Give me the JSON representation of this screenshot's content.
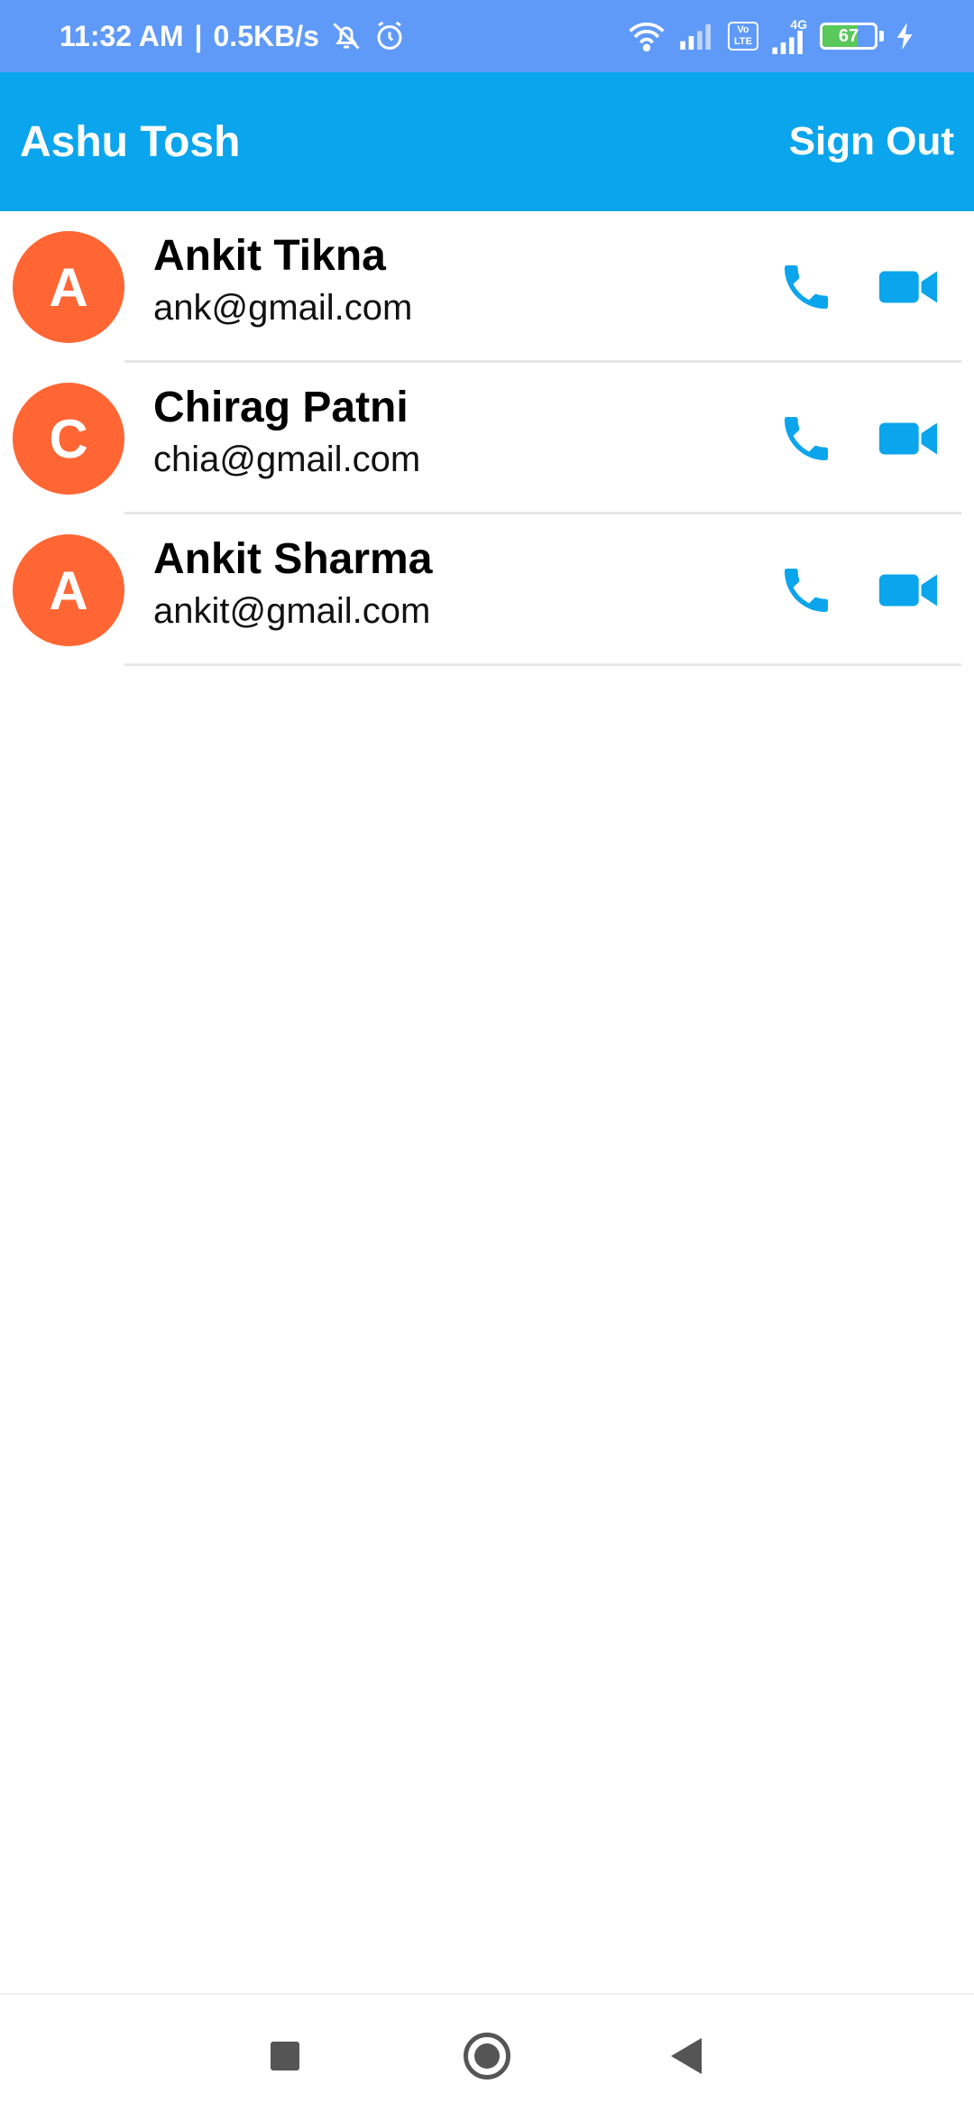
{
  "status_bar": {
    "time": "11:32 AM",
    "separator": "|",
    "network_speed": "0.5KB/s",
    "battery_level": "67",
    "battery_percent": 67,
    "icons": [
      "mute-icon",
      "alarm-icon",
      "wifi-icon",
      "signal-icon",
      "volte-icon",
      "signal-4g-icon",
      "battery-icon",
      "charging-icon"
    ],
    "volte_label_top": "Vo",
    "volte_label_bottom": "LTE",
    "network_type": "4G"
  },
  "app_bar": {
    "title": "Ashu Tosh",
    "sign_out_label": "Sign Out"
  },
  "contacts": [
    {
      "initial": "A",
      "name": "Ankit Tikna",
      "email": "ank@gmail.com"
    },
    {
      "initial": "C",
      "name": "Chirag Patni",
      "email": "chia@gmail.com"
    },
    {
      "initial": "A",
      "name": "Ankit Sharma",
      "email": "ankit@gmail.com"
    }
  ],
  "colors": {
    "status_bar": "#5f9af8",
    "app_bar": "#0aa5ec",
    "avatar": "#ff6634",
    "action_icons": "#0aa5ec",
    "battery_fill": "#58c95a"
  },
  "nav_bar": {
    "icons": [
      "recents-icon",
      "home-icon",
      "back-icon"
    ]
  }
}
